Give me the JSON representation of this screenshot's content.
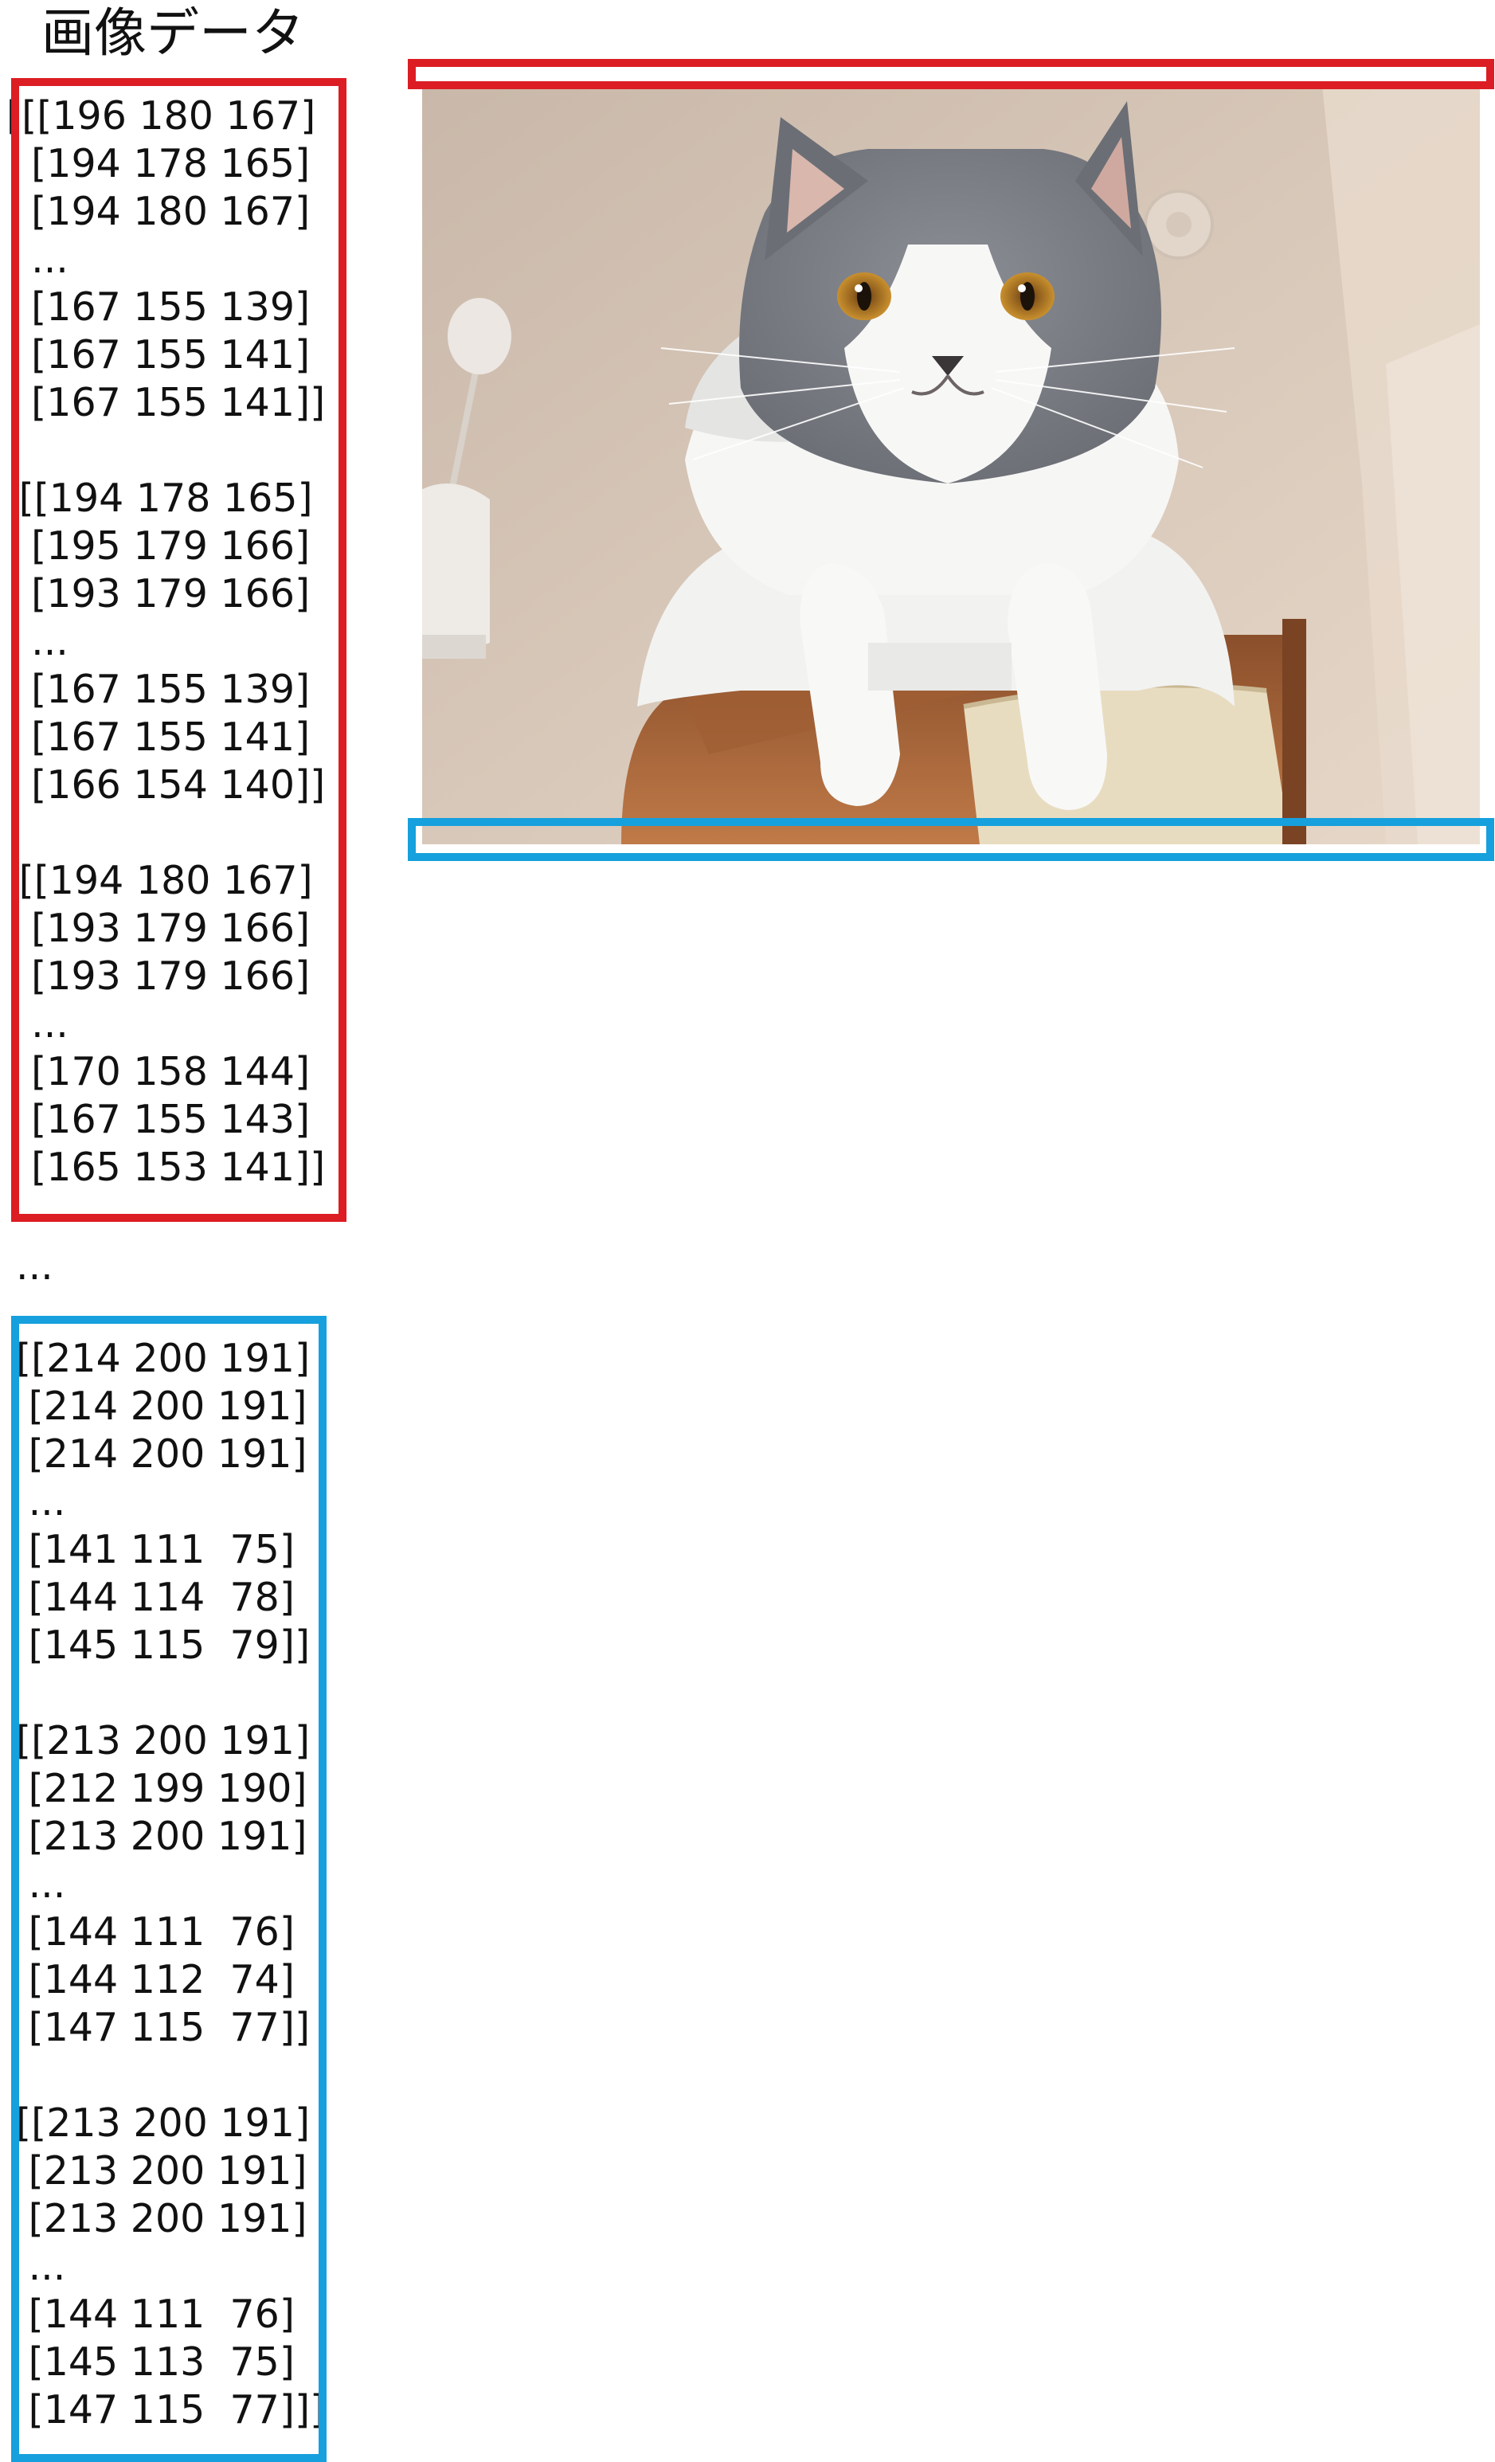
{
  "title": "画像データ",
  "array_text": {
    "first_rows": "[[[196 180 167]\n  [194 178 165]\n  [194 180 167]\n  ...\n  [167 155 139]\n  [167 155 141]\n  [167 155 141]]\n\n [[194 178 165]\n  [195 179 166]\n  [193 179 166]\n  ...\n  [167 155 139]\n  [167 155 141]\n  [166 154 140]]\n\n [[194 180 167]\n  [193 179 166]\n  [193 179 166]\n  ...\n  [170 158 144]\n  [167 155 143]\n  [165 153 141]]",
    "ellipsis": "...",
    "last_rows": "[[214 200 191]\n [214 200 191]\n [214 200 191]\n ...\n [141 111  75]\n [144 114  78]\n [145 115  79]]\n\n[[213 200 191]\n [212 199 190]\n [213 200 191]\n ...\n [144 111  76]\n [144 112  74]\n [147 115  77]]\n\n[[213 200 191]\n [213 200 191]\n [213 200 191]\n ...\n [144 111  76]\n [145 113  75]\n [147 115  77]]]"
  },
  "colors": {
    "top_highlight": "#dc1d24",
    "bottom_highlight": "#16a0dd"
  },
  "image": {
    "subject": "gray-and-white-cat-photo"
  }
}
